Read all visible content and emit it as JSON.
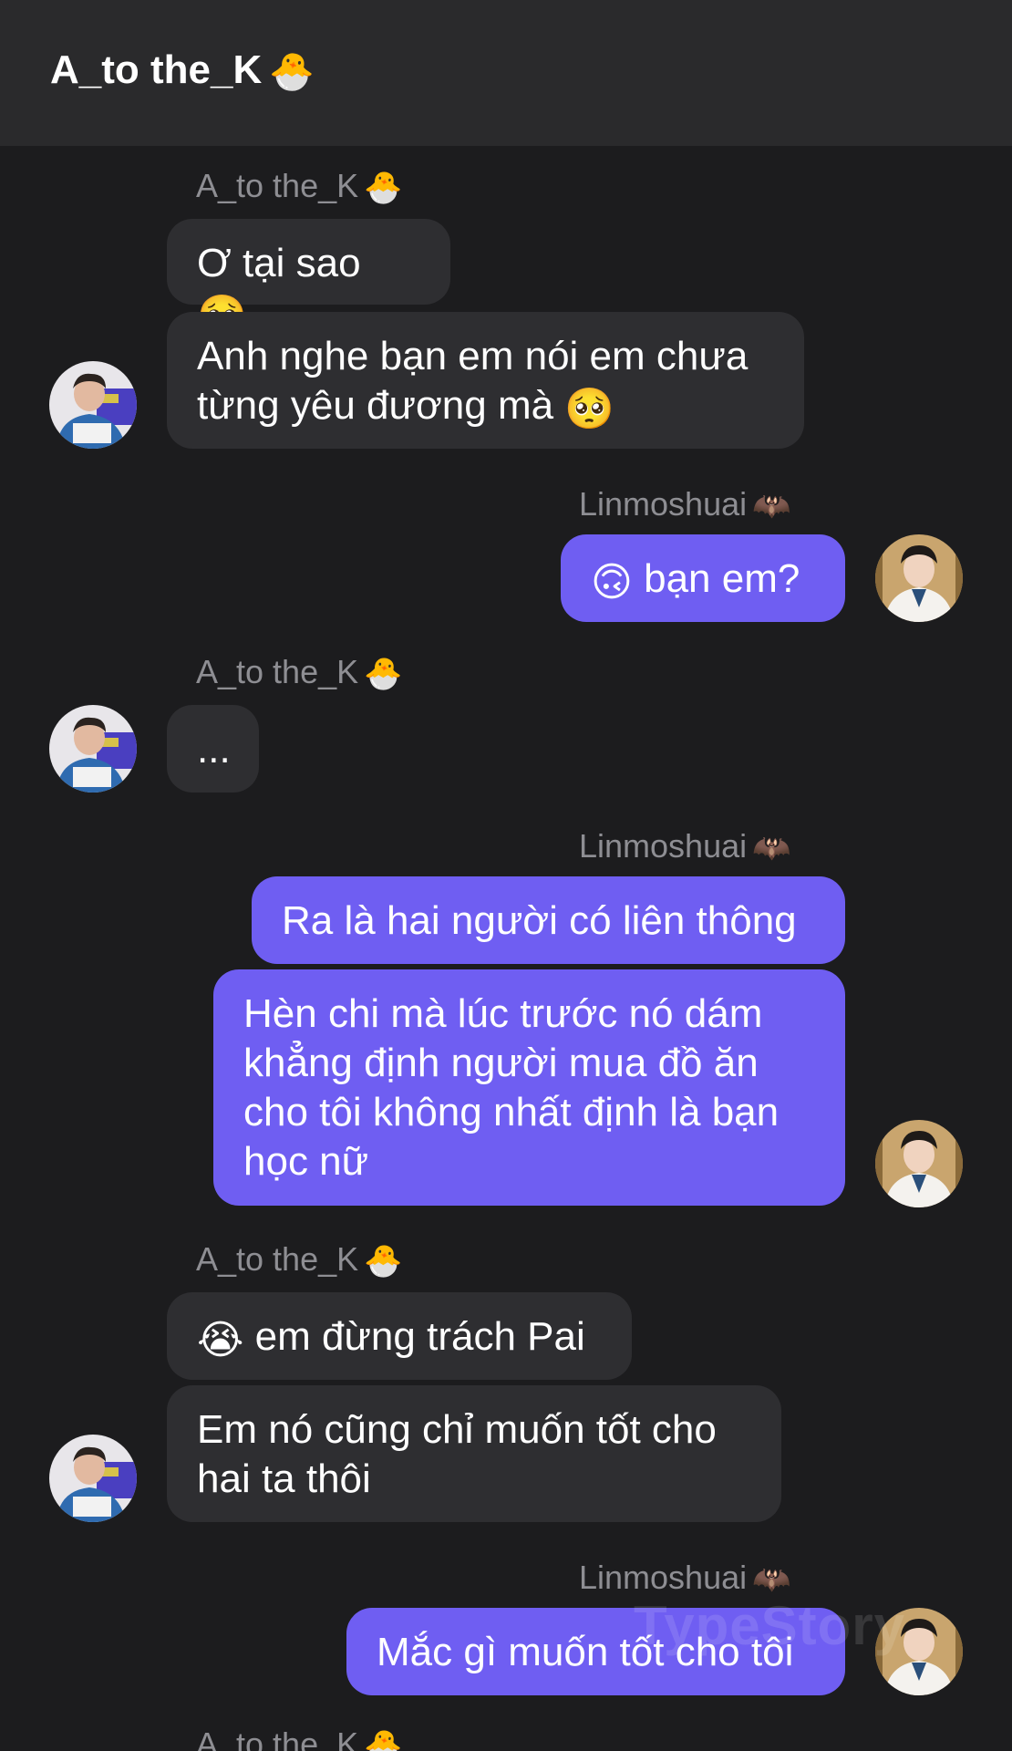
{
  "header": {
    "title": "A_to the_K",
    "title_emoji": "🐣"
  },
  "senders": {
    "a": {
      "name": "A_to the_K",
      "emoji": "🐣"
    },
    "l": {
      "name": "Linmoshuai",
      "emoji": "🦇"
    }
  },
  "messages": [
    {
      "side": "in",
      "text": "Ơ tại sao",
      "emoji_after": "🥺"
    },
    {
      "side": "in",
      "line1": "Anh nghe bạn em nói em chưa",
      "line2": "từng yêu đương mà",
      "emoji_after": "🥺"
    },
    {
      "side": "out",
      "emoji_before": "🙃",
      "text": "bạn em?"
    },
    {
      "side": "in",
      "text": "..."
    },
    {
      "side": "out",
      "text": "Ra là hai người có liên thông"
    },
    {
      "side": "out",
      "line1": "Hèn chi mà lúc trước nó dám",
      "line2": "khẳng định người mua đồ ăn",
      "line3": "cho tôi không nhất định là bạn",
      "line4": "học nữ"
    },
    {
      "side": "in",
      "emoji_before": "😭",
      "text": "em đừng trách Pai"
    },
    {
      "side": "in",
      "line1": "Em nó cũng chỉ muốn tốt cho",
      "line2": "hai ta thôi"
    },
    {
      "side": "out",
      "text": "Mắc gì muốn tốt cho tôi"
    }
  ],
  "watermark": "TypeStory",
  "colors": {
    "background": "#1c1c1e",
    "header": "#2a2a2c",
    "incoming_bubble": "#2e2e31",
    "outgoing_bubble": "#6f5ef2",
    "sender_name": "#8e8e93"
  }
}
